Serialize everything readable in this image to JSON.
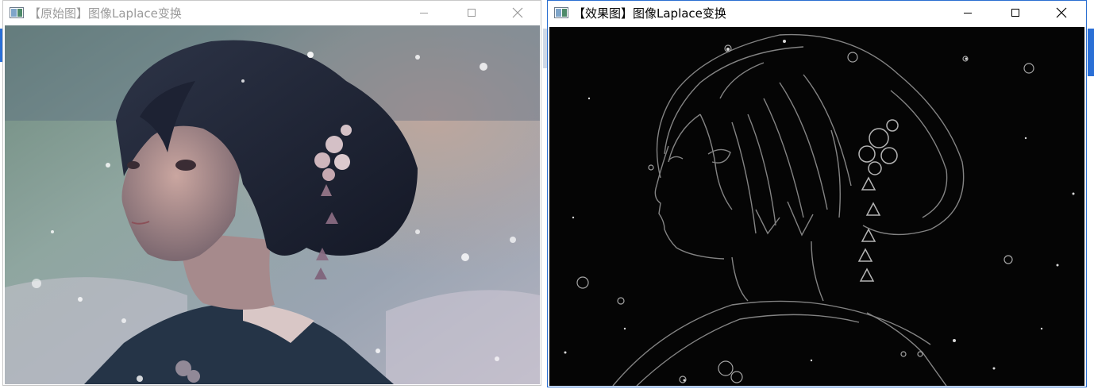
{
  "windows": [
    {
      "title": "【原始图】图像Laplace变换",
      "state": "inactive",
      "content": "original-image",
      "buttons": [
        "minimize",
        "maximize",
        "close"
      ]
    },
    {
      "title": "【效果图】图像Laplace变换",
      "state": "active",
      "content": "laplace-result-image",
      "buttons": [
        "minimize",
        "maximize",
        "close"
      ]
    }
  ],
  "icons": {
    "app": "window-app-icon",
    "minimize": "minimize-icon",
    "maximize": "maximize-icon",
    "close": "close-icon"
  },
  "colors": {
    "active_border": "#2b6fd1",
    "inactive_title": "#9a9a9a",
    "active_title": "#000000"
  }
}
